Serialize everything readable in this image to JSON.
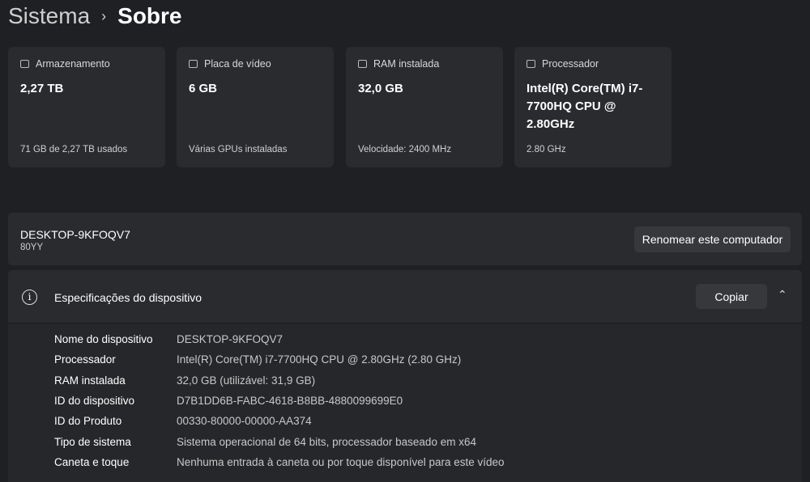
{
  "breadcrumb": {
    "parent": "Sistema",
    "separator": "›",
    "current": "Sobre"
  },
  "cards": [
    {
      "icon": "hard-drive-icon",
      "label": "Armazenamento",
      "value": "2,27 TB",
      "sub": "71 GB de 2,27 TB usados"
    },
    {
      "icon": "gpu-icon",
      "label": "Placa de vídeo",
      "value": "6 GB",
      "sub": "Várias GPUs instaladas"
    },
    {
      "icon": "ram-icon",
      "label": "RAM instalada",
      "value": "32,0 GB",
      "sub": "Velocidade: 2400 MHz"
    },
    {
      "icon": "cpu-icon",
      "label": "Processador",
      "value": "Intel(R) Core(TM) i7-7700HQ CPU @ 2.80GHz",
      "sub": "2.80 GHz"
    }
  ],
  "computer": {
    "name": "DESKTOP-9KFOQV7",
    "model": "80YY",
    "rename_label": "Renomear este computador"
  },
  "specs": {
    "title": "Especificações do dispositivo",
    "copy_label": "Copiar",
    "info_glyph": "i",
    "chevron": "⌃",
    "rows": [
      {
        "k": "Nome do dispositivo",
        "v": "DESKTOP-9KFOQV7"
      },
      {
        "k": "Processador",
        "v": "Intel(R) Core(TM) i7-7700HQ CPU @ 2.80GHz (2.80 GHz)"
      },
      {
        "k": "RAM instalada",
        "v": "32,0 GB (utilizável: 31,9 GB)"
      },
      {
        "k": "ID do dispositivo",
        "v": "D7B1DD6B-FABC-4618-B8BB-4880099699E0"
      },
      {
        "k": "ID do Produto",
        "v": "00330-80000-00000-AA374"
      },
      {
        "k": "Tipo de sistema",
        "v": "Sistema operacional de 64 bits, processador baseado em x64"
      },
      {
        "k": "Caneta e toque",
        "v": "Nenhuma entrada à caneta ou por toque disponível para este vídeo"
      }
    ]
  }
}
